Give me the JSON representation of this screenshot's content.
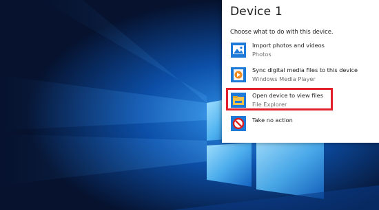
{
  "colors": {
    "flyout_background": "#ffffff",
    "highlight_border": "#e0202a",
    "desktop_background": "#06122e",
    "windows_logo_light": "#9fdcff",
    "windows_logo_dark": "#1a68c4"
  },
  "flyout": {
    "title": "Device 1",
    "subtitle": "Choose what to do with this device.",
    "options": [
      {
        "main": "Import photos and videos",
        "sub": "Photos",
        "icon": "photos-app-icon"
      },
      {
        "main": "Sync digital media files to this device",
        "sub": "Windows Media Player",
        "icon": "media-player-icon"
      },
      {
        "main": "Open device to view files",
        "sub": "File Explorer",
        "icon": "file-explorer-icon",
        "highlighted": true
      },
      {
        "main": "Take no action",
        "sub": "",
        "icon": "no-action-icon"
      }
    ]
  }
}
